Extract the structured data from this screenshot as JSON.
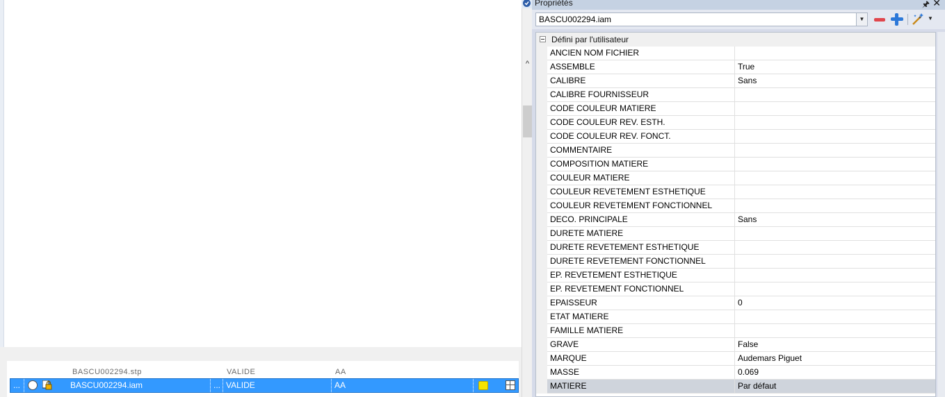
{
  "window": {
    "title": "Propriétés"
  },
  "toolbar": {
    "file_selected": "BASCU002294.iam"
  },
  "list": {
    "partial_row_text": "BASCU002294.stp",
    "partial_row_state": "VALIDE",
    "partial_row_rev": "AA",
    "selected_row": {
      "dots1": "...",
      "name": "BASCU002294.iam",
      "dots2": "...",
      "state": "VALIDE",
      "revision": "AA"
    }
  },
  "properties": {
    "category": "Défini par l'utilisateur",
    "rows": [
      {
        "name": "ANCIEN NOM FICHIER",
        "value": ""
      },
      {
        "name": "ASSEMBLE",
        "value": "True"
      },
      {
        "name": "CALIBRE",
        "value": "Sans"
      },
      {
        "name": "CALIBRE FOURNISSEUR",
        "value": ""
      },
      {
        "name": "CODE COULEUR MATIERE",
        "value": ""
      },
      {
        "name": "CODE COULEUR REV. ESTH.",
        "value": ""
      },
      {
        "name": "CODE COULEUR REV. FONCT.",
        "value": ""
      },
      {
        "name": "COMMENTAIRE",
        "value": ""
      },
      {
        "name": "COMPOSITION MATIERE",
        "value": ""
      },
      {
        "name": "COULEUR MATIERE",
        "value": ""
      },
      {
        "name": "COULEUR REVETEMENT ESTHETIQUE",
        "value": ""
      },
      {
        "name": "COULEUR REVETEMENT FONCTIONNEL",
        "value": ""
      },
      {
        "name": "DECO. PRINCIPALE",
        "value": "Sans"
      },
      {
        "name": "DURETE MATIERE",
        "value": ""
      },
      {
        "name": "DURETE REVETEMENT ESTHETIQUE",
        "value": ""
      },
      {
        "name": "DURETE REVETEMENT FONCTIONNEL",
        "value": ""
      },
      {
        "name": "EP. REVETEMENT ESTHETIQUE",
        "value": ""
      },
      {
        "name": "EP. REVETEMENT FONCTIONNEL",
        "value": ""
      },
      {
        "name": "EPAISSEUR",
        "value": "0"
      },
      {
        "name": "ETAT MATIERE",
        "value": ""
      },
      {
        "name": "FAMILLE MATIERE",
        "value": ""
      },
      {
        "name": "GRAVE",
        "value": "False"
      },
      {
        "name": "MARQUE",
        "value": "Audemars Piguet"
      },
      {
        "name": "MASSE",
        "value": "0.069"
      },
      {
        "name": "MATIERE",
        "value": "Par défaut"
      }
    ]
  },
  "icons": {
    "pin": "pin-icon",
    "close": "close-icon",
    "remove": "minus-icon",
    "add": "plus-icon",
    "wand": "magic-wand-icon"
  }
}
